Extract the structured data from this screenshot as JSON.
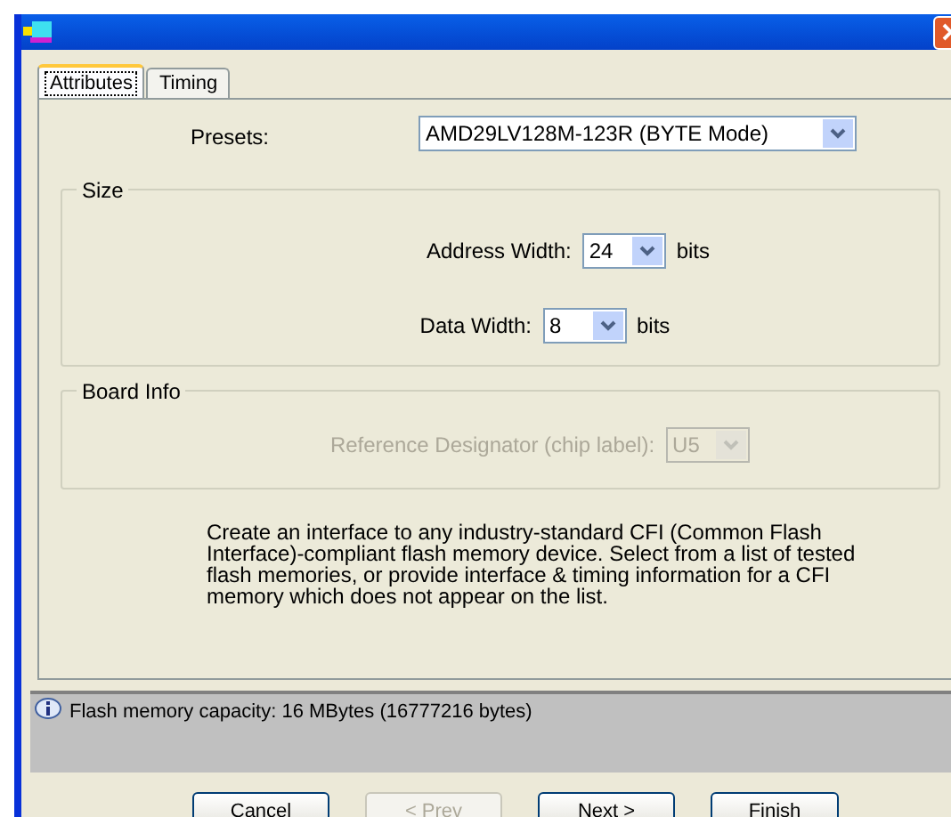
{
  "tabs": [
    {
      "label": "Attributes",
      "selected": true
    },
    {
      "label": "Timing",
      "selected": false
    }
  ],
  "presets": {
    "label": "Presets:",
    "value": "AMD29LV128M-123R (BYTE Mode)"
  },
  "size_group": {
    "title": "Size",
    "fields": [
      {
        "label": "Address Width:",
        "value": "24",
        "unit": "bits"
      },
      {
        "label": "Data Width:",
        "value": "8",
        "unit": "bits"
      }
    ]
  },
  "board_info": {
    "title": "Board Info",
    "label": "Reference Designator (chip label):",
    "value": "U5",
    "disabled": true
  },
  "description": "Create an interface to any industry-standard CFI (Common Flash Interface)-compliant flash memory device.  Select from a list of tested flash memories, or provide interface & timing information for a CFI memory which does not appear on the list.",
  "status": "Flash memory capacity: 16 MBytes (16777216 bytes)",
  "buttons": [
    {
      "label": "Cancel",
      "disabled": false
    },
    {
      "label": "< Prev",
      "disabled": true
    },
    {
      "label": "Next >",
      "disabled": false
    },
    {
      "label": "Finish",
      "disabled": false
    }
  ]
}
